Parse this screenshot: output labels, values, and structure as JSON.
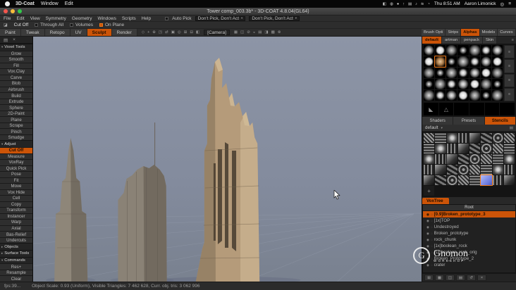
{
  "colors": {
    "accent_orange": "#cc5408",
    "viewport_bg": "#838b9d",
    "tower_tan": "#b59b7a",
    "selected_stencil_blue": "#8e9cf2"
  },
  "macos_bar": {
    "app_menus": [
      "3D-Coat",
      "Window",
      "Edit"
    ],
    "status_icons": [
      "◧",
      "◍",
      "●",
      "↑",
      "▤",
      "♪",
      "≋",
      "◔"
    ],
    "clock": "Thu 8:51 AM",
    "user": "Aaron Limonick",
    "spotlight_icon": "◎",
    "notification_icon": "≡"
  },
  "title_bar": {
    "title": "Tower comp_003.3b* - 3D-COAT 4.8.04(GL64)"
  },
  "menu_bar": {
    "items": [
      "File",
      "Edit",
      "View",
      "Symmetry",
      "Geometry",
      "Windows",
      "Scripts",
      "Help"
    ],
    "auto_pick_label": "Auto Pick",
    "pick_dropdown_1": "Don't Pick, Don't Act",
    "pick_dropdown_2": "Don't Pick, Don't Act",
    "dropdown_arrow": "▾"
  },
  "options_bar": {
    "tool_icon": "◪",
    "tool_label": "Cut Off",
    "toggles": [
      {
        "label": "Through All",
        "checked": false
      },
      {
        "label": "Volumes",
        "checked": false
      },
      {
        "label": "On Plane",
        "checked": true
      }
    ]
  },
  "mode_tabs": {
    "tabs": [
      "Paint",
      "Tweak",
      "Retopo",
      "UV",
      "Sculpt",
      "Render"
    ],
    "active": "Sculpt"
  },
  "viewport_toolbar": {
    "icons_left": [
      "◇",
      "+",
      "⊕",
      "◳",
      "⇄",
      "▣",
      "◎",
      "⊞",
      "⊟",
      "◧"
    ],
    "camera_label": "[Camera]",
    "icons_right": [
      "▦",
      "◫",
      "⊘",
      "◒",
      "▤",
      "◨",
      "▩",
      "⊗"
    ]
  },
  "left_panel": {
    "top_icons": [
      "▤",
      "×"
    ],
    "active_tool": "Cut Off",
    "expanded_arrow": "▾",
    "collapsed_arrow": "▸",
    "sections": [
      {
        "title": "Voxel Tools",
        "expanded": true,
        "tools": [
          "Grow",
          "Smooth",
          "Fill",
          "Vox.Clay",
          "Carve",
          "Blob",
          "Airbrush",
          "Build",
          "Extrude",
          "Sphere",
          "2D-Paint",
          "Plane",
          "Scrape",
          "Pinch",
          "Smudge"
        ]
      },
      {
        "title": "Adjust",
        "expanded": true,
        "tools": [
          "Cut Off",
          "Measure",
          "VoxRay",
          "Quick Pick",
          "Pose",
          "Fit",
          "Move",
          "Vox Hide",
          "Cell",
          "Copy",
          "Transform",
          "Instancer",
          "Warp",
          "Axial",
          "Bas-Relief",
          "Undercuts"
        ]
      },
      {
        "title": "Objects",
        "expanded": false,
        "tools": []
      },
      {
        "title": "Surface Tools",
        "expanded": false,
        "tools": []
      },
      {
        "title": "Commands",
        "expanded": true,
        "tools": [
          "Res+",
          "Resample",
          "Clear"
        ]
      }
    ]
  },
  "right_panel": {
    "tabs": [
      "Brush Opti",
      "Strips",
      "Alphas",
      "Models",
      "Curves"
    ],
    "active_tab": "Alphas",
    "tab_arrows": "◂▸",
    "alpha_sets": [
      "default",
      "artman",
      "penpack",
      "Skin"
    ],
    "active_set": "default",
    "alpha_sets_menu_icon": "≡",
    "alphas_grid": {
      "count": 35,
      "selected_index": 8
    },
    "alpha_side_buttons": [
      "≡",
      "≡",
      "≡",
      "≡"
    ],
    "alpha_big_row": [
      "◣",
      "△",
      "",
      "",
      "",
      ""
    ],
    "lower_tabs": [
      "Shaders",
      "Presets",
      "Stencils"
    ],
    "active_lower_tab": "Stencils",
    "stencil_set_label": "default",
    "stencil_dropdown_icon": "▾",
    "stencil_menu_icon": "▤",
    "stencils_grid": {
      "count": 41,
      "selected_index": 37,
      "plus_index": 40,
      "plus_glyph": "+"
    },
    "voxtree": {
      "title": "VoxTree",
      "root_label": "Root",
      "eye_icon": "◉",
      "ghost_icon": "◌",
      "items": [
        {
          "label": "[0.9]Broken_prototype_3",
          "selected": true
        },
        {
          "label": "[1x]TOP",
          "selected": false
        },
        {
          "label": "Undestroyed",
          "selected": false
        },
        {
          "label": "Broken_prototype",
          "selected": false
        },
        {
          "label": "rock_chunk",
          "selected": false
        },
        {
          "label": "[1x]boolean_rock",
          "selected": false
        },
        {
          "label": "[1x]boolean_rock_orig",
          "selected": false
        },
        {
          "label": "Broken_Prototype_2",
          "selected": false
        },
        {
          "label": "crater",
          "selected": false
        }
      ]
    },
    "bottom_icons": [
      "⊞",
      "▦",
      "◫",
      "▤",
      "↺",
      "×"
    ]
  },
  "status_bar": {
    "fps": "fps:39...",
    "info": "Object Scale: 0.93 (Uniform), Visible Triangles: 7 462 628, Curr. obj. tris: 3 062 996"
  },
  "watermark": {
    "logo_letter": "G",
    "name": "Gnomon",
    "subtitle": "WORKSHOP"
  }
}
